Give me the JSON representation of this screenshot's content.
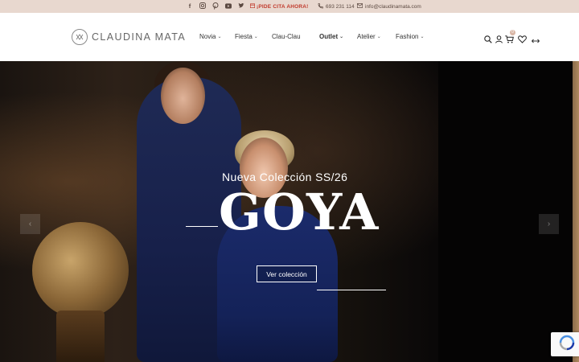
{
  "topbar": {
    "social_icons": [
      "facebook-icon",
      "instagram-icon",
      "pinterest-icon",
      "youtube-icon",
      "twitter-icon"
    ],
    "cita": "¡PIDE CITA AHORA!",
    "phone": "693 231 114",
    "email": "info@claudinamata.com"
  },
  "brand": {
    "name": "CLAUDINA MATA"
  },
  "nav": {
    "items": [
      {
        "label": "Novia",
        "dropdown": true
      },
      {
        "label": "Fiesta",
        "dropdown": true
      },
      {
        "label": "Clau-Clau",
        "dropdown": false
      },
      {
        "label": "Outlet",
        "dropdown": true
      },
      {
        "label": "Atelier",
        "dropdown": true
      },
      {
        "label": "Fashion",
        "dropdown": true
      }
    ]
  },
  "header_icons": {
    "search": "search-icon",
    "account": "user-icon",
    "cart": "cart-icon",
    "wishlist": "heart-icon",
    "compare": "compare-icon",
    "cart_count": "0"
  },
  "hero": {
    "subtitle": "Nueva Colección SS/26",
    "title": "GOYA",
    "cta": "Ver colección"
  },
  "colors": {
    "topbar_bg": "#e8d8cf",
    "cita": "#c0392b",
    "badge": "#d8b5a4"
  }
}
